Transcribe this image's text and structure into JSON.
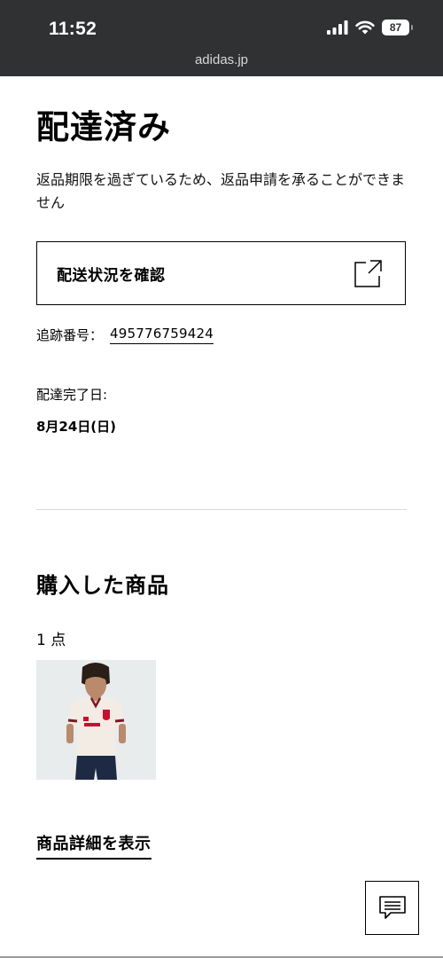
{
  "status_bar": {
    "time": "11:52",
    "battery": "87",
    "url": "adidas.jp"
  },
  "order": {
    "status_title": "配達済み",
    "return_notice": "返品期限を過ぎているため、返品申請を承ることができません",
    "track_button_label": "配送状況を確認",
    "tracking_label": "追跡番号：",
    "tracking_number": "495776759424",
    "delivered_label": "配達完了日:",
    "delivered_date": "8月24日(日)"
  },
  "purchased": {
    "title": "購入した商品",
    "count": "1 点",
    "product_image_icon": "jersey-product-photo",
    "details_link": "商品詳細を表示"
  },
  "chat": {
    "icon": "chat-icon"
  },
  "colors": {
    "status_bar_bg": "#2f3133",
    "product_bg": "#e8eced",
    "divider": "#d9d9d9"
  }
}
